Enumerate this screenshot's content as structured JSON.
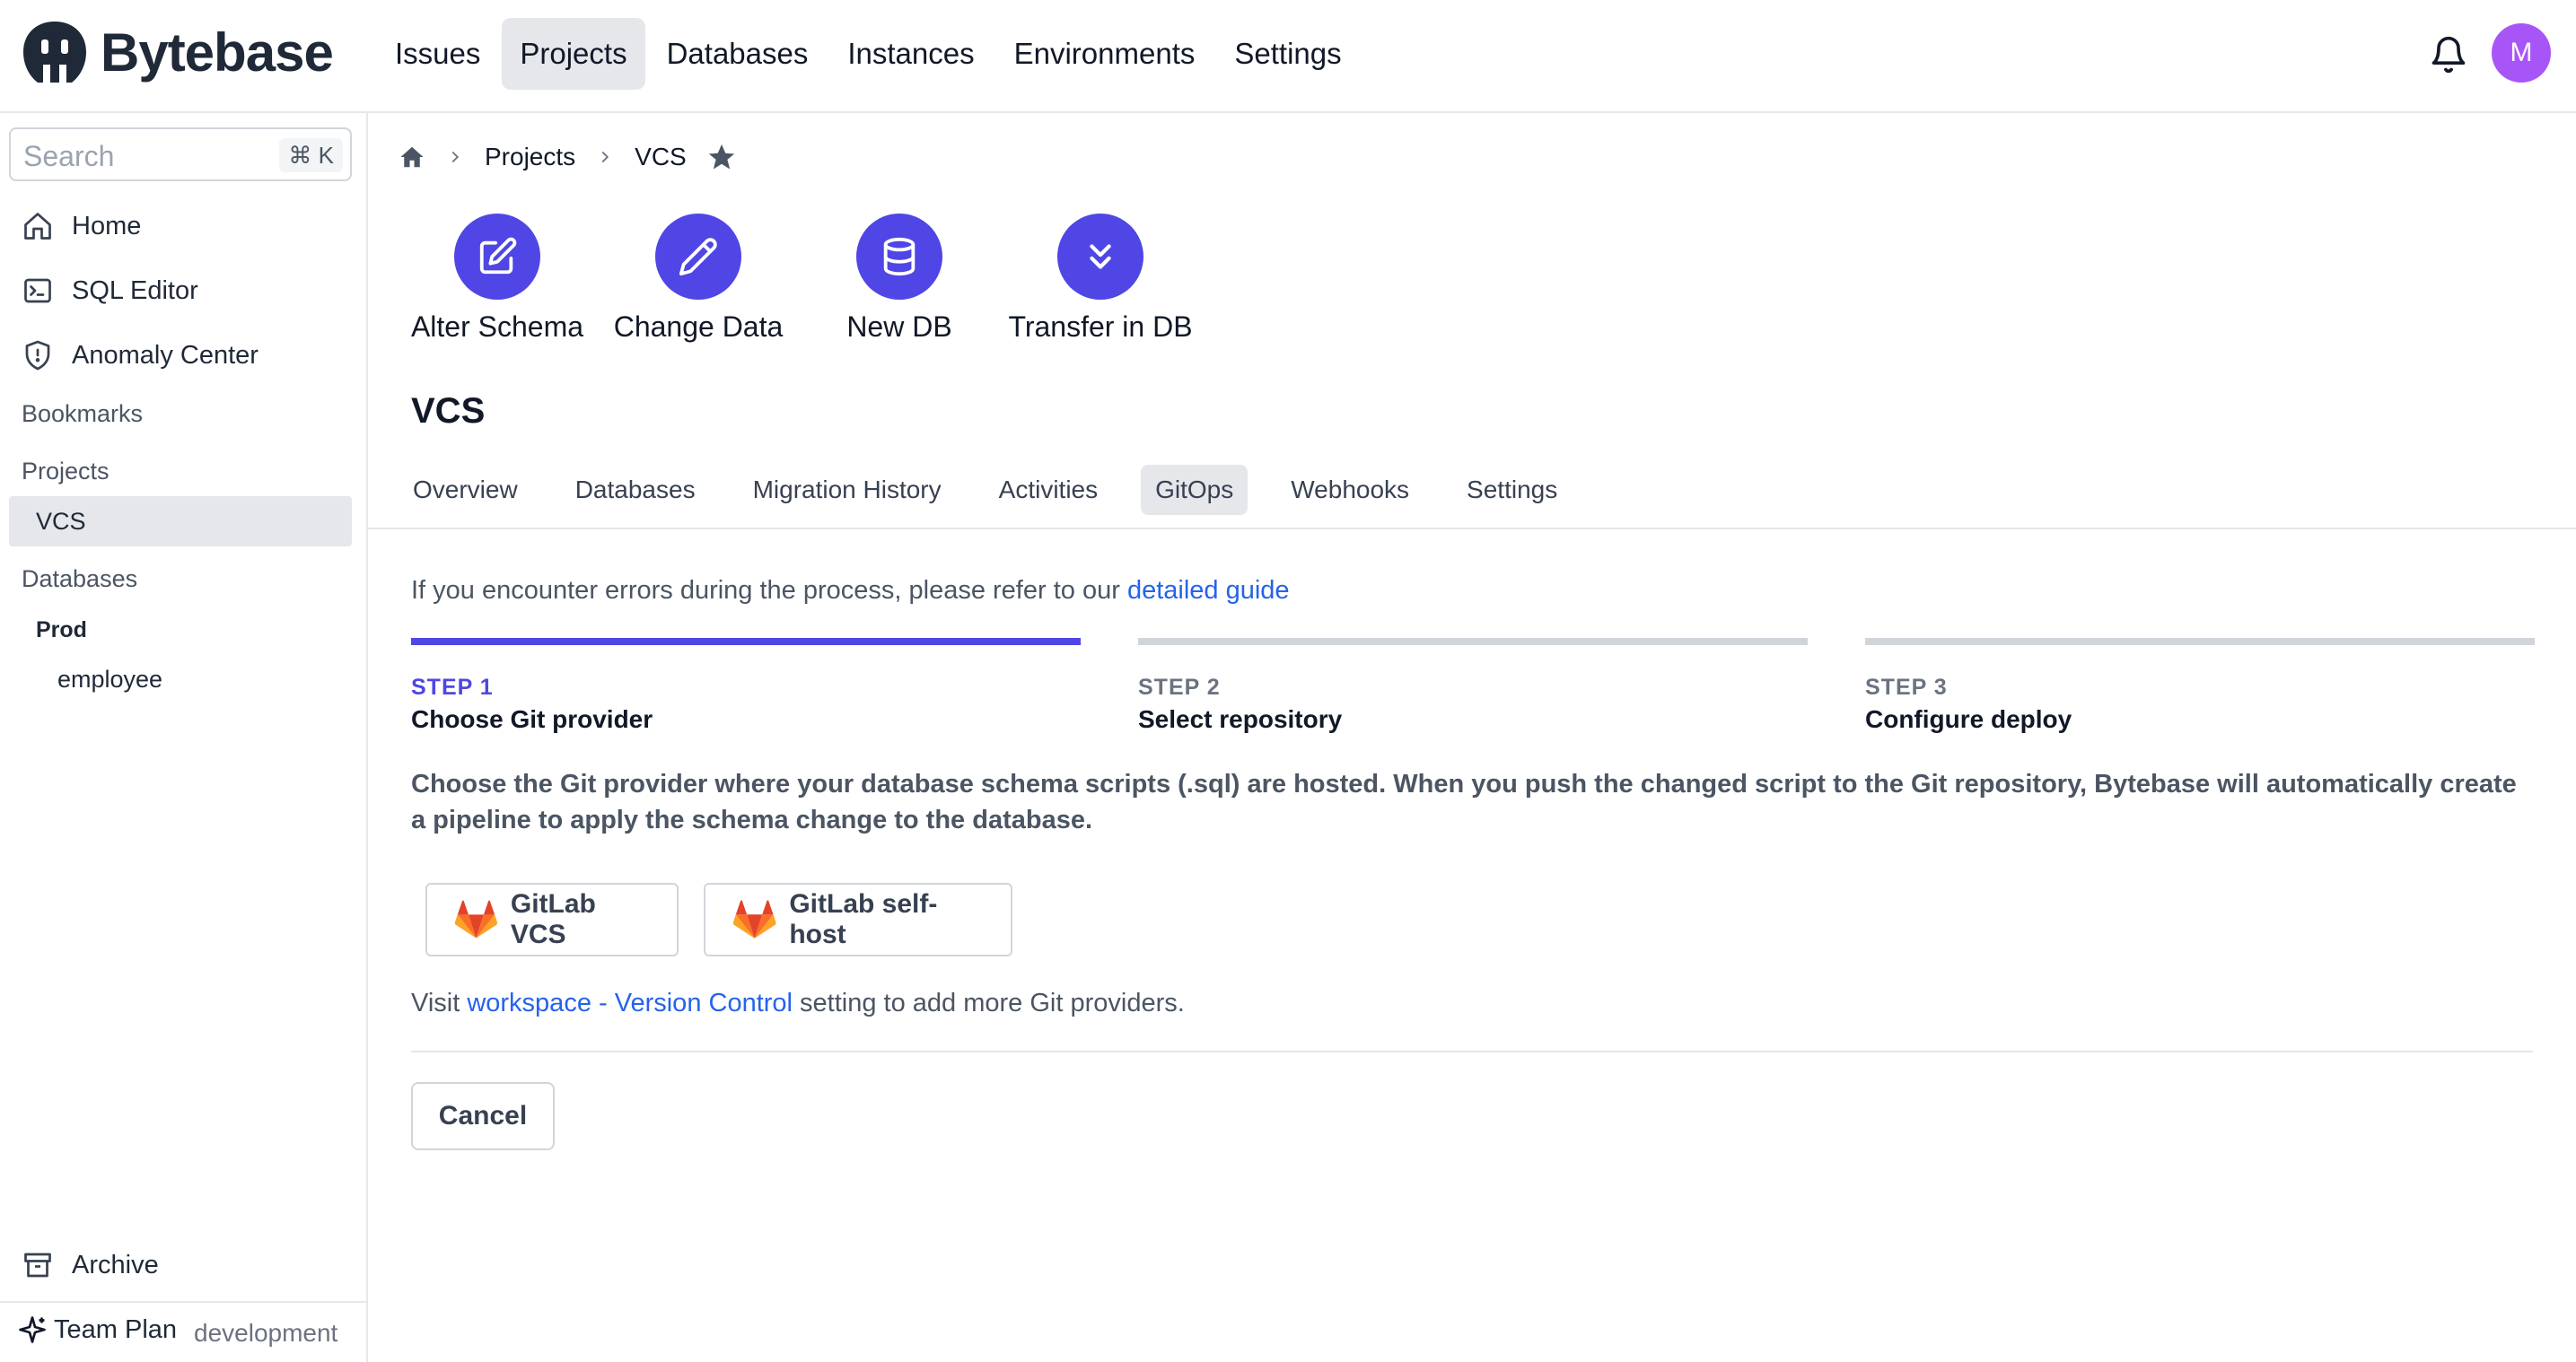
{
  "header": {
    "brand": "Bytebase",
    "nav": [
      {
        "label": "Issues",
        "active": false
      },
      {
        "label": "Projects",
        "active": true
      },
      {
        "label": "Databases",
        "active": false
      },
      {
        "label": "Instances",
        "active": false
      },
      {
        "label": "Environments",
        "active": false
      },
      {
        "label": "Settings",
        "active": false
      }
    ],
    "avatar_initial": "M",
    "avatar_color": "#a855f7"
  },
  "sidebar": {
    "search_placeholder": "Search",
    "search_shortcut": "⌘ K",
    "items": [
      {
        "label": "Home",
        "icon": "home-icon"
      },
      {
        "label": "SQL Editor",
        "icon": "terminal-icon"
      },
      {
        "label": "Anomaly Center",
        "icon": "shield-icon"
      }
    ],
    "bookmarks_label": "Bookmarks",
    "projects_label": "Projects",
    "project_active": "VCS",
    "databases_label": "Databases",
    "env_label": "Prod",
    "database_item": "employee",
    "archive_label": "Archive",
    "plan_label": "Team Plan",
    "plan_env": "development"
  },
  "breadcrumb": {
    "projects": "Projects",
    "current": "VCS"
  },
  "quick_actions": [
    {
      "label": "Alter Schema",
      "icon": "edit-square-icon"
    },
    {
      "label": "Change Data",
      "icon": "pencil-icon"
    },
    {
      "label": "New DB",
      "icon": "database-icon"
    },
    {
      "label": "Transfer in DB",
      "icon": "chevrons-down-icon"
    }
  ],
  "page": {
    "title": "VCS",
    "tabs": [
      {
        "label": "Overview",
        "active": false
      },
      {
        "label": "Databases",
        "active": false
      },
      {
        "label": "Migration History",
        "active": false
      },
      {
        "label": "Activities",
        "active": false
      },
      {
        "label": "GitOps",
        "active": true
      },
      {
        "label": "Webhooks",
        "active": false
      },
      {
        "label": "Settings",
        "active": false
      }
    ]
  },
  "gitops": {
    "info_prefix": "If you encounter errors during the process, please refer to our ",
    "info_link": "detailed guide",
    "steps": [
      {
        "num": "STEP 1",
        "title": "Choose Git provider",
        "active": true
      },
      {
        "num": "STEP 2",
        "title": "Select repository",
        "active": false
      },
      {
        "num": "STEP 3",
        "title": "Configure deploy",
        "active": false
      }
    ],
    "description": "Choose the Git provider where your database schema scripts (.sql) are hosted. When you push the changed script to the Git repository, Bytebase will automatically create a pipeline to apply the schema change to the database.",
    "providers": [
      {
        "label": "GitLab VCS",
        "icon": "gitlab-icon"
      },
      {
        "label": "GitLab self-host",
        "icon": "gitlab-icon"
      }
    ],
    "visit_prefix": "Visit ",
    "visit_link": "workspace - Version Control",
    "visit_suffix": " setting to add more Git providers.",
    "cancel_label": "Cancel"
  },
  "colors": {
    "accent": "#4f46e5",
    "link": "#2563eb",
    "gitlab_orange": "#e24329"
  }
}
